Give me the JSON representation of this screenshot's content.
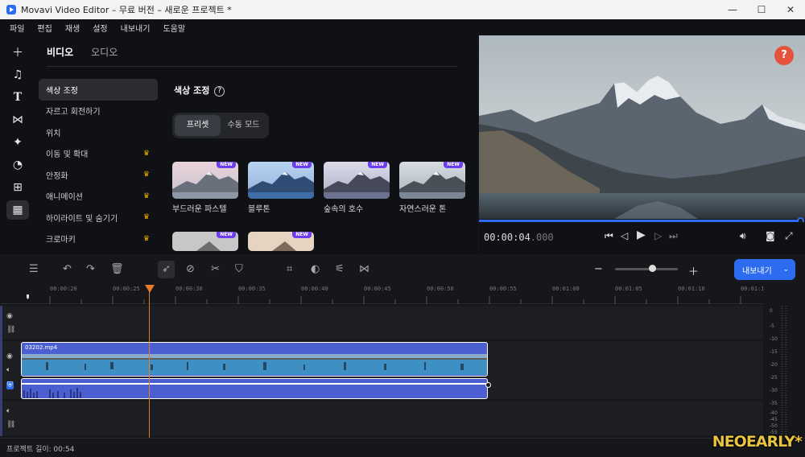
{
  "window": {
    "title": "Movavi Video Editor – 무료 버전 – 새로운 프로젝트 *"
  },
  "menu": [
    "파일",
    "편집",
    "재생",
    "설정",
    "내보내기",
    "도움말"
  ],
  "panel": {
    "tabs": [
      "비디오",
      "오디오"
    ],
    "tools": [
      {
        "label": "색상 조정",
        "premium": false
      },
      {
        "label": "자르고 회전하기",
        "premium": false
      },
      {
        "label": "위치",
        "premium": false
      },
      {
        "label": "이동 및 확대",
        "premium": true
      },
      {
        "label": "안정화",
        "premium": true
      },
      {
        "label": "애니메이션",
        "premium": true
      },
      {
        "label": "하이라이트 및 숨기기",
        "premium": true
      },
      {
        "label": "크로마키",
        "premium": true
      }
    ],
    "section_title": "색상 조정",
    "modes": [
      "프리셋",
      "수동 모드"
    ],
    "presets": [
      {
        "label": "부드러운 파스텔",
        "badge": "NEW"
      },
      {
        "label": "블루톤",
        "badge": "NEW"
      },
      {
        "label": "숲속의 호수",
        "badge": "NEW"
      },
      {
        "label": "자연스러운 톤",
        "badge": "NEW"
      },
      {
        "label": "",
        "badge": "NEW"
      },
      {
        "label": "",
        "badge": "NEW"
      }
    ]
  },
  "player": {
    "time": "00:00:04",
    "time_ms": ".000",
    "progress": 1.0
  },
  "timeline": {
    "ruler": [
      "00:00:20",
      "00:00:25",
      "00:00:30",
      "00:00:35",
      "00:00:40",
      "00:00:45",
      "00:00:50",
      "00:00:55",
      "00:01:00",
      "00:01:05",
      "00:01:10",
      "00:01:1"
    ],
    "clip_name": "03202.mp4",
    "meter_labels": [
      "0",
      "-5",
      "-10",
      "-15",
      "-20",
      "-25",
      "-30",
      "-35",
      "-40",
      "-45",
      "-50",
      "-55"
    ]
  },
  "export_label": "내보내기",
  "status": "프로젝트 길이: 00:54",
  "watermark": "NEOEARLY*",
  "colors": {
    "accent": "#2d6cf0",
    "playhead": "#e57a2a",
    "clip": "#4c5fd0",
    "crown": "#f2b400",
    "badge": "#6d3df0"
  }
}
